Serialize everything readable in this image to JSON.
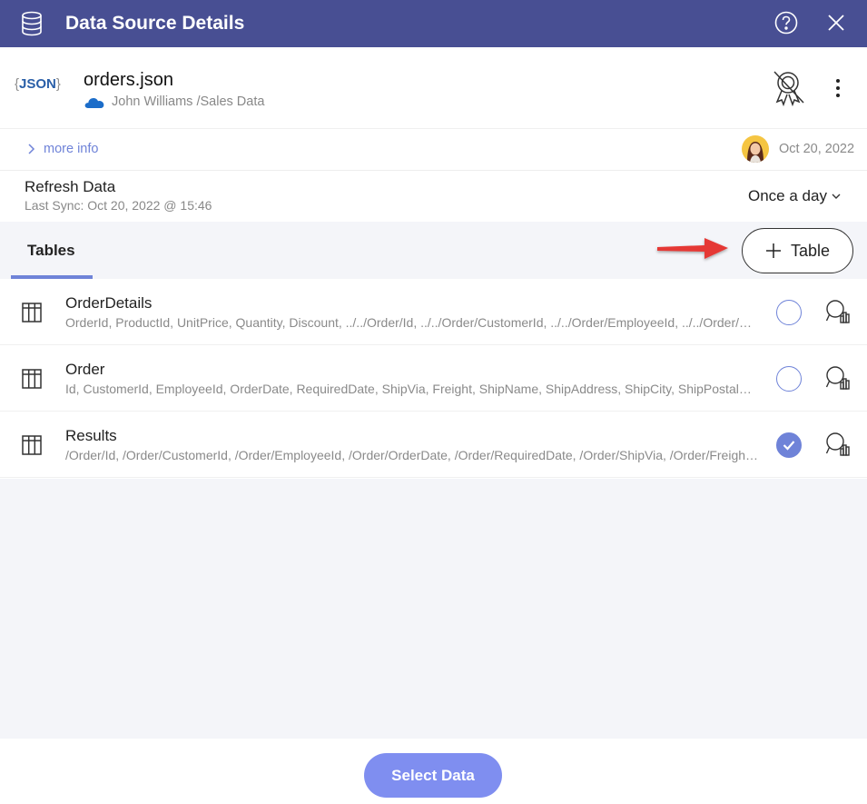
{
  "titlebar": {
    "title": "Data Source Details",
    "icons": [
      "database-icon",
      "help-icon",
      "close-icon"
    ]
  },
  "source": {
    "logo_text": "JSON",
    "name": "orders.json",
    "path": "John Williams /Sales Data",
    "icons": [
      "onedrive-cloud-icon",
      "certified-off-icon",
      "more-vertical-icon"
    ]
  },
  "info": {
    "more_info": "more info",
    "modified_date": "Oct 20, 2022"
  },
  "refresh": {
    "title": "Refresh Data",
    "last_sync": "Last Sync: Oct 20, 2022 @ 15:46",
    "frequency": "Once a day"
  },
  "tabs": {
    "active": "Tables",
    "add_button": "Table"
  },
  "tables": [
    {
      "name": "OrderDetails",
      "columns": "OrderId, ProductId, UnitPrice, Quantity, Discount, ../../Order/Id, ../../Order/CustomerId, ../../Order/EmployeeId, ../../Order/OrderDate",
      "selected": false
    },
    {
      "name": "Order",
      "columns": "Id, CustomerId, EmployeeId, OrderDate, RequiredDate, ShipVia, Freight, ShipName, ShipAddress, ShipCity, ShipPostalCode, ShipCountry",
      "selected": false
    },
    {
      "name": "Results",
      "columns": "/Order/Id, /Order/CustomerId, /Order/EmployeeId, /Order/OrderDate, /Order/RequiredDate, /Order/ShipVia, /Order/Freight, /Order/ShipName",
      "selected": true
    }
  ],
  "footer": {
    "select_button": "Select Data"
  },
  "colors": {
    "header_bg": "#484f93",
    "accent": "#6f83d8",
    "button": "#7f8ef0",
    "annotation_arrow": "#e53935"
  }
}
